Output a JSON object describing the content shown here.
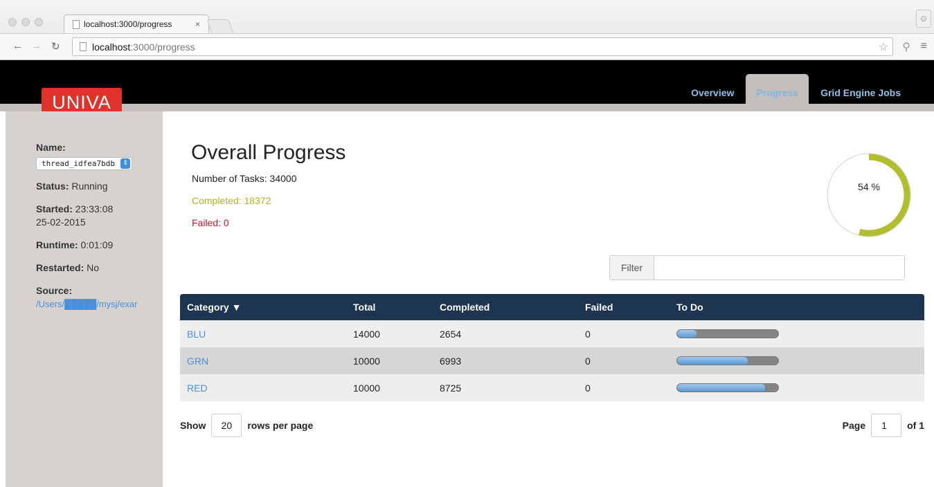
{
  "browser": {
    "tab_title": "localhost:3000/progress",
    "tab_close": "×",
    "url_host": "localhost",
    "url_path": ":3000/progress"
  },
  "app": {
    "logo_text": "UNIVA",
    "nav": [
      {
        "label": "Overview",
        "active": false
      },
      {
        "label": "Progress",
        "active": true
      },
      {
        "label": "Grid Engine Jobs",
        "active": false
      }
    ]
  },
  "sidebar": {
    "name_label": "Name:",
    "name_value": "thread_idfea7bdb",
    "status_label": "Status:",
    "status_value": " Running",
    "started_label": "Started:",
    "started_value": " 23:33:08",
    "started_date": "25-02-2015",
    "runtime_label": "Runtime:",
    "runtime_value": " 0:01:09",
    "restarted_label": "Restarted:",
    "restarted_value": " No",
    "source_label": "Source:",
    "source_value": "/Users/█████/mysj/exar"
  },
  "main": {
    "title": "Overall Progress",
    "tasks": "Number of Tasks: 34000",
    "completed": "Completed: 18372",
    "failed": "Failed: 0",
    "progress_percent": 54,
    "progress_label": "54 %",
    "filter_label": "Filter",
    "filter_value": ""
  },
  "table": {
    "headers": [
      "Category ▼",
      "Total",
      "Completed",
      "Failed",
      "To Do"
    ],
    "rows": [
      {
        "category": "BLU",
        "total": "14000",
        "completed": "2654",
        "failed": "0",
        "todo_fraction": 0.19
      },
      {
        "category": "GRN",
        "total": "10000",
        "completed": "6993",
        "failed": "0",
        "todo_fraction": 0.7
      },
      {
        "category": "RED",
        "total": "10000",
        "completed": "8725",
        "failed": "0",
        "todo_fraction": 0.87
      }
    ]
  },
  "pager": {
    "show_label": "Show",
    "rows_value": "20",
    "rows_label": "rows per page",
    "page_label": "Page",
    "page_value": "1",
    "of_label": "of 1"
  },
  "colors": {
    "completed": "#b3b31a",
    "failed": "#d0142f",
    "header_bg": "#1d3551",
    "progress_arc": "#b3be2e"
  }
}
